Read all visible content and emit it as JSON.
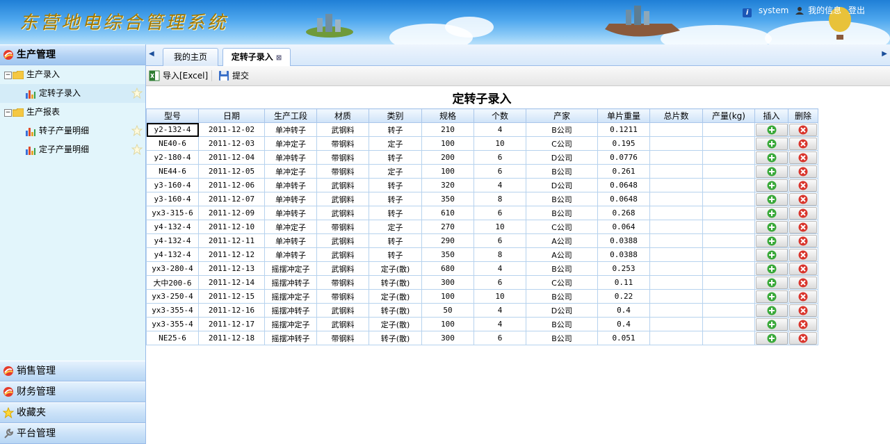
{
  "header": {
    "system_title": "东营地电综合管理系统",
    "user_name": "system",
    "my_info": "我的信息",
    "logout": "登出"
  },
  "sidebar": {
    "sections": [
      {
        "label": "生产管理",
        "icon": "production-icon"
      },
      {
        "label": "销售管理",
        "icon": "sales-icon"
      },
      {
        "label": "财务管理",
        "icon": "finance-icon"
      },
      {
        "label": "收藏夹",
        "icon": "star-icon"
      },
      {
        "label": "平台管理",
        "icon": "wrench-icon"
      }
    ],
    "tree": [
      {
        "label": "生产录入",
        "type": "folder",
        "toggle": "−"
      },
      {
        "label": "定转子录入",
        "type": "page"
      },
      {
        "label": "生产报表",
        "type": "folder",
        "toggle": "−"
      },
      {
        "label": "转子产量明细",
        "type": "page"
      },
      {
        "label": "定子产量明细",
        "type": "page"
      }
    ]
  },
  "tabs": [
    {
      "label": "我的主页"
    },
    {
      "label": "定转子录入",
      "close": "⊠"
    }
  ],
  "toolbar": {
    "import_label": "导入[Excel]",
    "submit_label": "提交"
  },
  "page_title": "定转子录入",
  "table": {
    "columns": [
      "型号",
      "日期",
      "生产工段",
      "材质",
      "类别",
      "规格",
      "个数",
      "产家",
      "单片重量",
      "总片数",
      "产量(kg)",
      "插入",
      "删除"
    ],
    "rows": [
      [
        "y2-132-4",
        "2011-12-02",
        "单冲转子",
        "武钢料",
        "转子",
        "210",
        "4",
        "B公司",
        "0.1211",
        "",
        ""
      ],
      [
        "NE40-6",
        "2011-12-03",
        "单冲定子",
        "带钢料",
        "定子",
        "100",
        "10",
        "C公司",
        "0.195",
        "",
        ""
      ],
      [
        "y2-180-4",
        "2011-12-04",
        "单冲转子",
        "带钢料",
        "转子",
        "200",
        "6",
        "D公司",
        "0.0776",
        "",
        ""
      ],
      [
        "NE44-6",
        "2011-12-05",
        "单冲定子",
        "带钢料",
        "定子",
        "100",
        "6",
        "B公司",
        "0.261",
        "",
        ""
      ],
      [
        "y3-160-4",
        "2011-12-06",
        "单冲转子",
        "武钢料",
        "转子",
        "320",
        "4",
        "D公司",
        "0.0648",
        "",
        ""
      ],
      [
        "y3-160-4",
        "2011-12-07",
        "单冲转子",
        "武钢料",
        "转子",
        "350",
        "8",
        "B公司",
        "0.0648",
        "",
        ""
      ],
      [
        "yx3-315-6",
        "2011-12-09",
        "单冲转子",
        "武钢料",
        "转子",
        "610",
        "6",
        "B公司",
        "0.268",
        "",
        ""
      ],
      [
        "y4-132-4",
        "2011-12-10",
        "单冲定子",
        "带钢料",
        "定子",
        "270",
        "10",
        "C公司",
        "0.064",
        "",
        ""
      ],
      [
        "y4-132-4",
        "2011-12-11",
        "单冲转子",
        "武钢料",
        "转子",
        "290",
        "6",
        "A公司",
        "0.0388",
        "",
        ""
      ],
      [
        "y4-132-4",
        "2011-12-12",
        "单冲转子",
        "武钢料",
        "转子",
        "350",
        "8",
        "A公司",
        "0.0388",
        "",
        ""
      ],
      [
        "yx3-280-4",
        "2011-12-13",
        "摇摆冲定子",
        "武钢料",
        "定子(散)",
        "680",
        "4",
        "B公司",
        "0.253",
        "",
        ""
      ],
      [
        "大中200-6",
        "2011-12-14",
        "摇摆冲转子",
        "带钢料",
        "转子(散)",
        "300",
        "6",
        "C公司",
        "0.11",
        "",
        ""
      ],
      [
        "yx3-250-4",
        "2011-12-15",
        "摇摆冲定子",
        "带钢料",
        "定子(散)",
        "100",
        "10",
        "B公司",
        "0.22",
        "",
        ""
      ],
      [
        "yx3-355-4",
        "2011-12-16",
        "摇摆冲转子",
        "武钢料",
        "转子(散)",
        "50",
        "4",
        "D公司",
        "0.4",
        "",
        ""
      ],
      [
        "yx3-355-4",
        "2011-12-17",
        "摇摆冲定子",
        "武钢料",
        "定子(散)",
        "100",
        "4",
        "B公司",
        "0.4",
        "",
        ""
      ],
      [
        "NE25-6",
        "2011-12-18",
        "摇摆冲转子",
        "带钢料",
        "转子(散)",
        "300",
        "6",
        "B公司",
        "0.051",
        "",
        ""
      ]
    ]
  }
}
